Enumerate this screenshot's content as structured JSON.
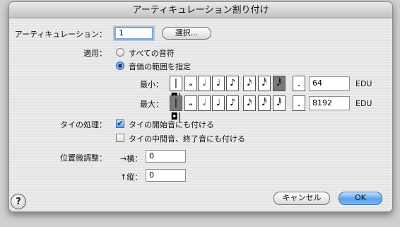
{
  "dialog": {
    "title": "アーティキュレーション割り付け"
  },
  "articulation": {
    "label": "アーティキュレーション：",
    "value": "1",
    "select_button": "選択..."
  },
  "apply": {
    "label": "適用：",
    "option_all": "すべての音符",
    "option_range": "音価の範囲を指定",
    "selected": "range",
    "min_label": "最小：",
    "max_label": "最大：",
    "min_value": "64",
    "max_value": "8192",
    "unit": "EDU"
  },
  "note_buttons": {
    "symbols": [
      "|◘|",
      "𝅝",
      "𝅗𝅥",
      "♩",
      "♪",
      "𝅘𝅥𝅯",
      "𝅘𝅥𝅰",
      "𝅘𝅥𝅱",
      "."
    ],
    "icons": [
      "double-whole-note-icon",
      "whole-note-icon",
      "half-note-icon",
      "quarter-note-icon",
      "eighth-note-icon",
      "sixteenth-note-icon",
      "thirty-second-note-icon",
      "sixty-fourth-note-icon",
      "dot-icon"
    ],
    "min_selected_index": 7,
    "max_selected_index": 0
  },
  "tie": {
    "label": "タイの処理：",
    "start_label": "タイの開始音にも付ける",
    "start_checked": true,
    "middle_label": "タイの中間音、終了音にも付ける",
    "middle_checked": false
  },
  "position": {
    "label": "位置微調整：",
    "horizontal_label": "→横：",
    "horizontal_value": "0",
    "vertical_label": "↑縦：",
    "vertical_value": "0"
  },
  "buttons": {
    "help": "?",
    "cancel": "キャンセル",
    "ok": "OK"
  },
  "colors": {
    "default_button": "#5aa1ee",
    "focus_ring": "#7fa6d8",
    "selected_note": "#7a7a7a"
  }
}
